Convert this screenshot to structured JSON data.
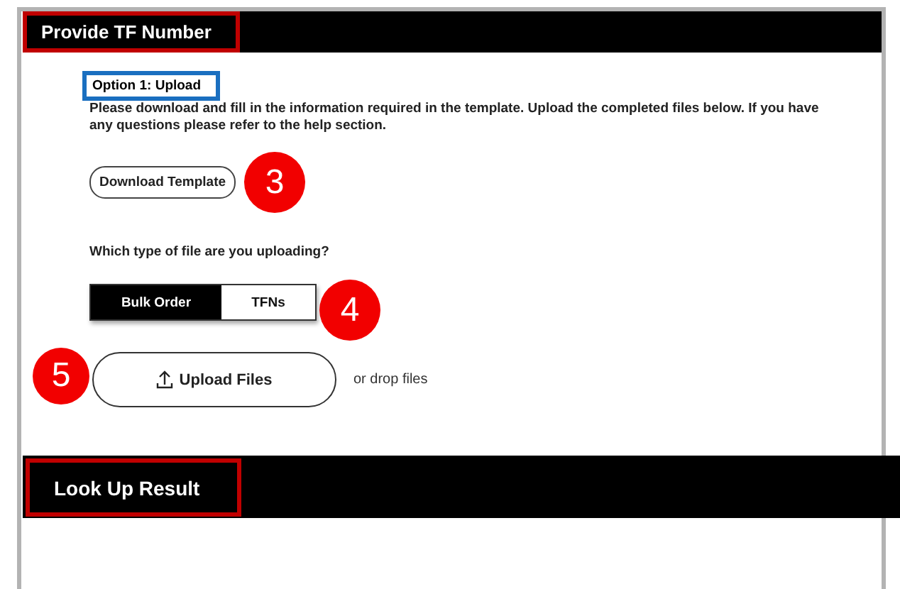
{
  "upload_section": {
    "title": {
      "text": "Provide TF Number",
      "outlined": true
    },
    "option_label": {
      "text": "Option 1: Upload",
      "outlined": true
    },
    "instructions": "Please download and fill in the information required in the template. Upload the completed files below. If you have any questions please refer to the help section.",
    "download_button": {
      "label": "Download Template",
      "callout": "3"
    },
    "file_type": {
      "question": "Which type of file are you uploading?",
      "callout": "4",
      "options": [
        {
          "label": "Bulk Order",
          "selected": true
        },
        {
          "label": "TFNs",
          "selected": false
        }
      ]
    },
    "upload": {
      "button": "Upload Files",
      "hint": "or drop files",
      "callout": "5"
    }
  },
  "result_section": {
    "title": {
      "text": "Look Up Result",
      "outlined": true
    }
  }
}
